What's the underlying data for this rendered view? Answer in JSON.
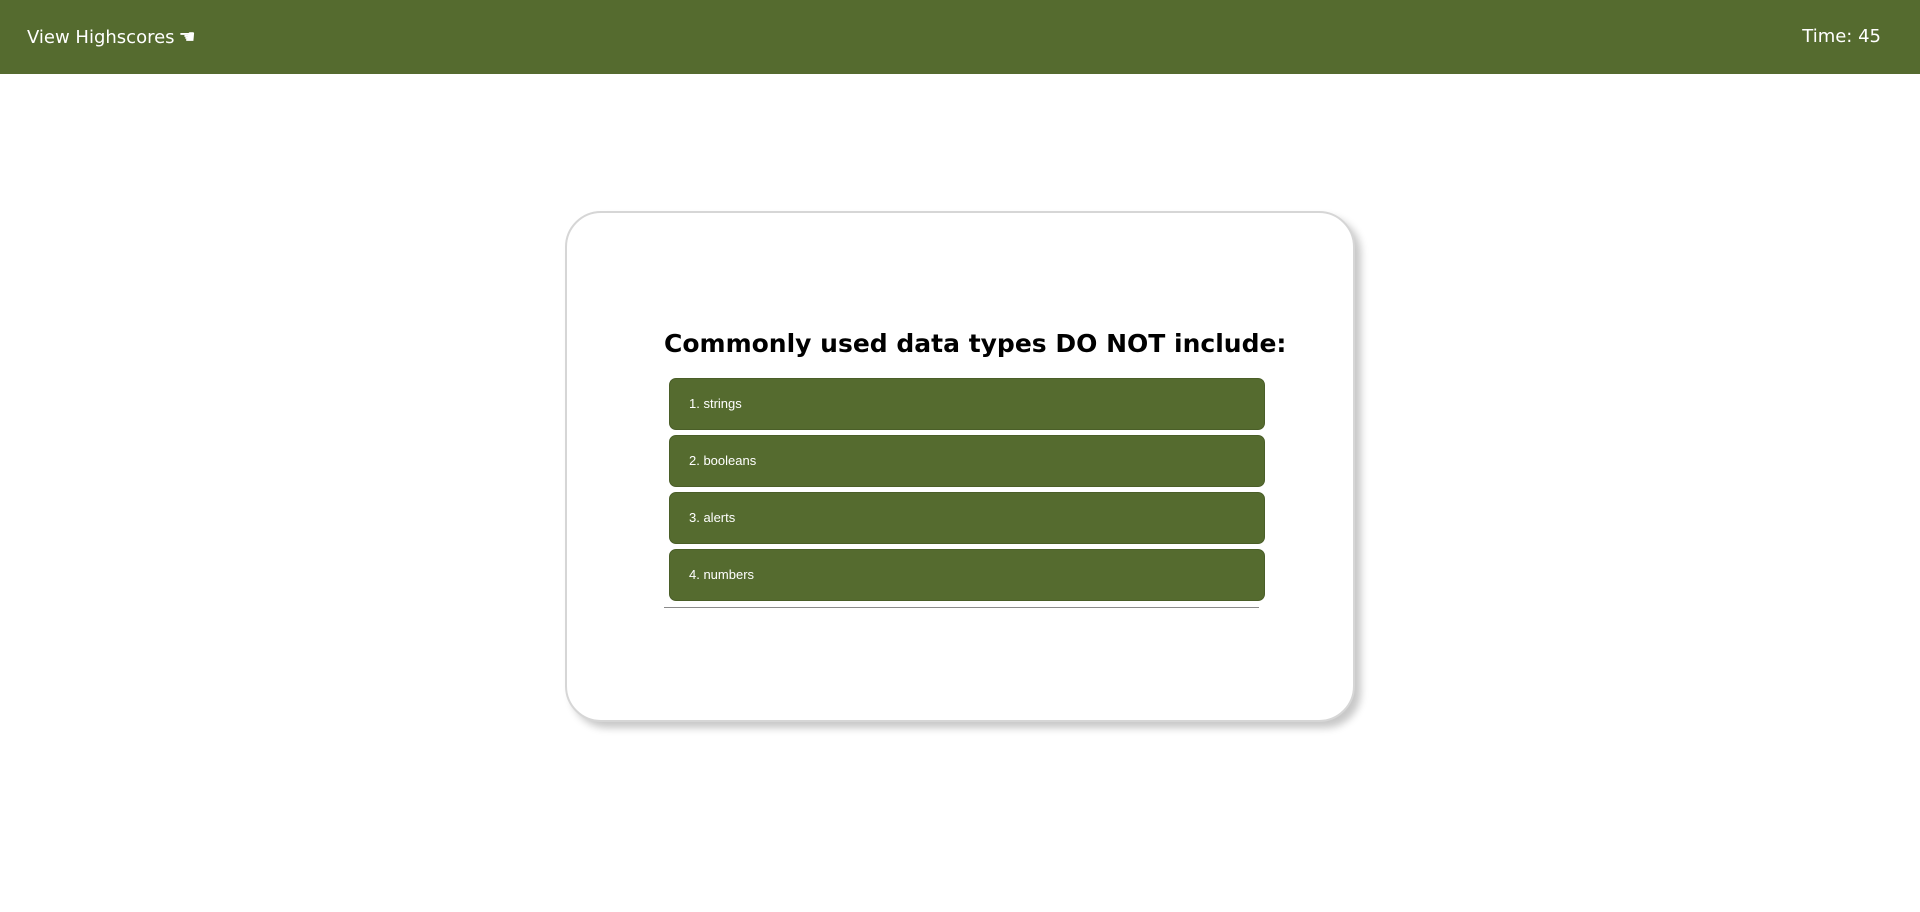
{
  "header": {
    "highscores_label": "View Highscores",
    "highscores_icon": "pointing-hand-icon",
    "timer_text": "Time: 45"
  },
  "quiz": {
    "question": "Commonly used data types DO NOT include:",
    "choices": [
      {
        "label": "1. strings"
      },
      {
        "label": "2. booleans"
      },
      {
        "label": "3. alerts"
      },
      {
        "label": "4. numbers"
      }
    ]
  },
  "colors": {
    "accent": "#556b2f",
    "text_on_accent": "#ffffff",
    "card_border": "#d6d6d6"
  }
}
